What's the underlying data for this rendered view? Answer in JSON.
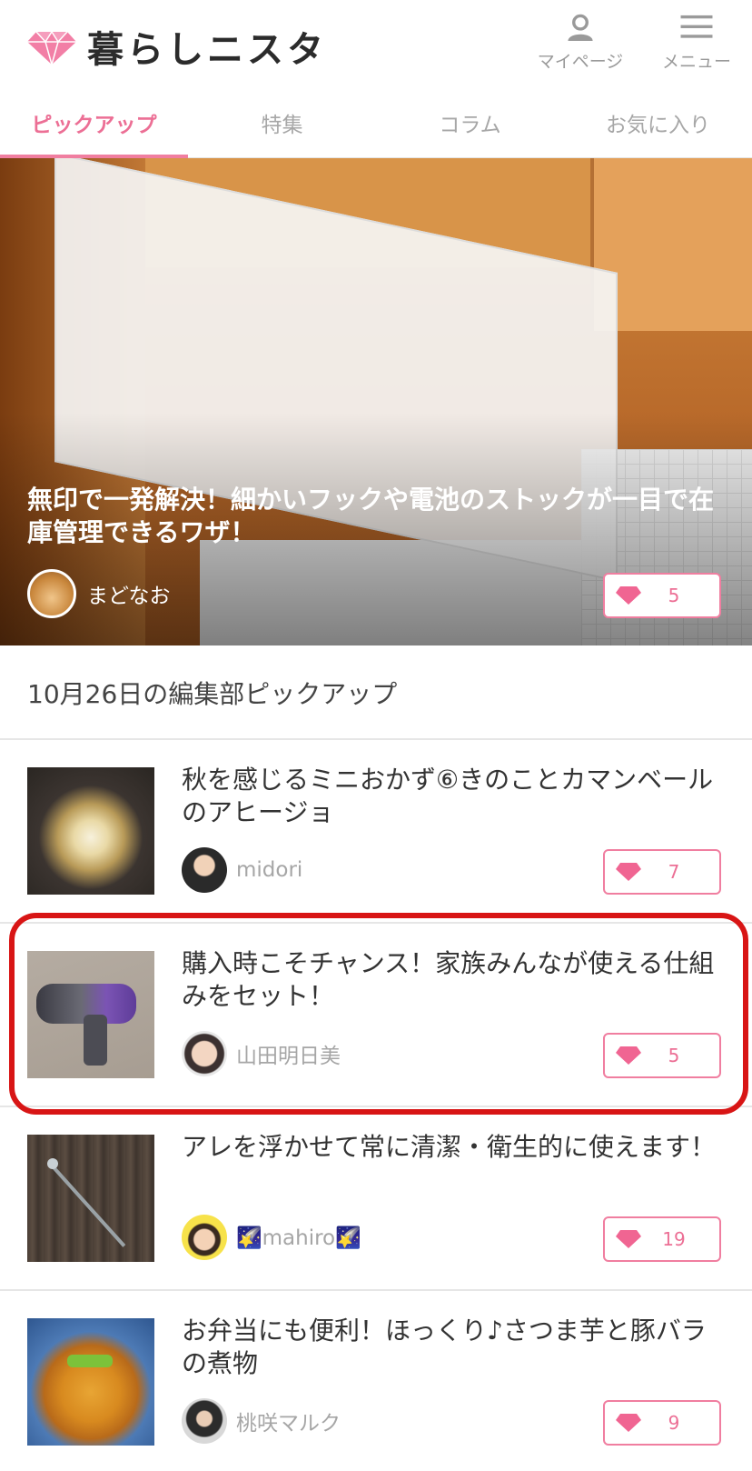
{
  "header": {
    "logo_text": "暮らしニスタ",
    "mypage_label": "マイページ",
    "menu_label": "メニュー"
  },
  "tabs": [
    {
      "label": "ピックアップ",
      "active": true
    },
    {
      "label": "特集",
      "active": false
    },
    {
      "label": "コラム",
      "active": false
    },
    {
      "label": "お気に入り",
      "active": false
    }
  ],
  "hero": {
    "title": "無印で一発解決！細かいフックや電池のストックが一目で在庫管理できるワザ！",
    "author": "まどなお",
    "likes": "5"
  },
  "section": {
    "title": "10月26日の編集部ピックアップ"
  },
  "articles": [
    {
      "title": "秋を感じるミニおかず⑥きのことカマンベールのアヒージョ",
      "author": "midori",
      "likes": "7"
    },
    {
      "title": "購入時こそチャンス！家族みんなが使える仕組みをセット！",
      "author": "山田明日美",
      "likes": "5"
    },
    {
      "title": "アレを浮かせて常に清潔・衛生的に使えます！",
      "author": "🌠mahiro🌠",
      "likes": "19"
    },
    {
      "title": "お弁当にも便利！ほっくり♪さつま芋と豚バラの煮物",
      "author": "桃咲マルク",
      "likes": "9"
    }
  ],
  "colors": {
    "accent_pink": "#ec6f95",
    "highlight_red": "#d81515"
  }
}
